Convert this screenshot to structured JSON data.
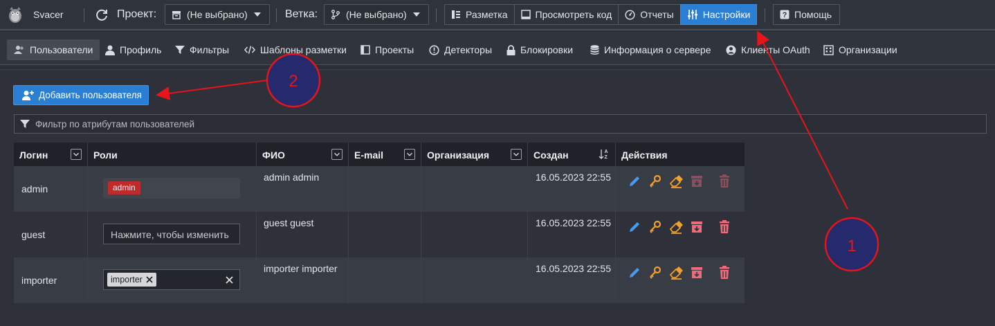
{
  "header": {
    "app_name": "Svacer",
    "project_label": "Проект:",
    "project_value": "(Не выбрано)",
    "branch_label": "Ветка:",
    "branch_value": "(Не выбрано)",
    "buttons": [
      "Разметка",
      "Просмотреть код",
      "Отчеты",
      "Настройки"
    ],
    "help": "Помощь",
    "active_button": "Настройки"
  },
  "subnav": {
    "items": [
      "Пользователи",
      "Профиль",
      "Фильтры",
      "Шаблоны разметки",
      "Проекты",
      "Детекторы",
      "Блокировки",
      "Информация о сервере",
      "Клиенты OAuth",
      "Организации"
    ],
    "active": "Пользователи"
  },
  "main": {
    "add_user_label": "Добавить пользователя",
    "filter_placeholder": "Фильтр по атрибутам пользователей"
  },
  "table": {
    "columns": [
      "Логин",
      "Роли",
      "ФИО",
      "E-mail",
      "Организация",
      "Создан",
      "Действия"
    ],
    "rows": [
      {
        "login": "admin",
        "roles": [
          "admin"
        ],
        "role_placeholder": "",
        "fio": "admin admin",
        "email": "",
        "org": "",
        "created": "16.05.2023 22:55"
      },
      {
        "login": "guest",
        "roles": [],
        "role_placeholder": "Нажмите, чтобы изменить",
        "fio": "guest guest",
        "email": "",
        "org": "",
        "created": "16.05.2023 22:55"
      },
      {
        "login": "importer",
        "roles": [
          "importer"
        ],
        "role_placeholder": "",
        "fio": "importer importer",
        "email": "",
        "org": "",
        "created": "16.05.2023 22:55"
      }
    ]
  },
  "annotations": [
    {
      "label": "1"
    },
    {
      "label": "2"
    }
  ],
  "colors": {
    "accent": "#2a7fd4",
    "annotation_stroke": "#e8141c",
    "annotation_fill": "#242a6b",
    "admin_tag": "#c12a2a",
    "edit_icon": "#4a9bf0",
    "key_icon": "#f0a030",
    "delete_icon": "#f06a7a"
  }
}
